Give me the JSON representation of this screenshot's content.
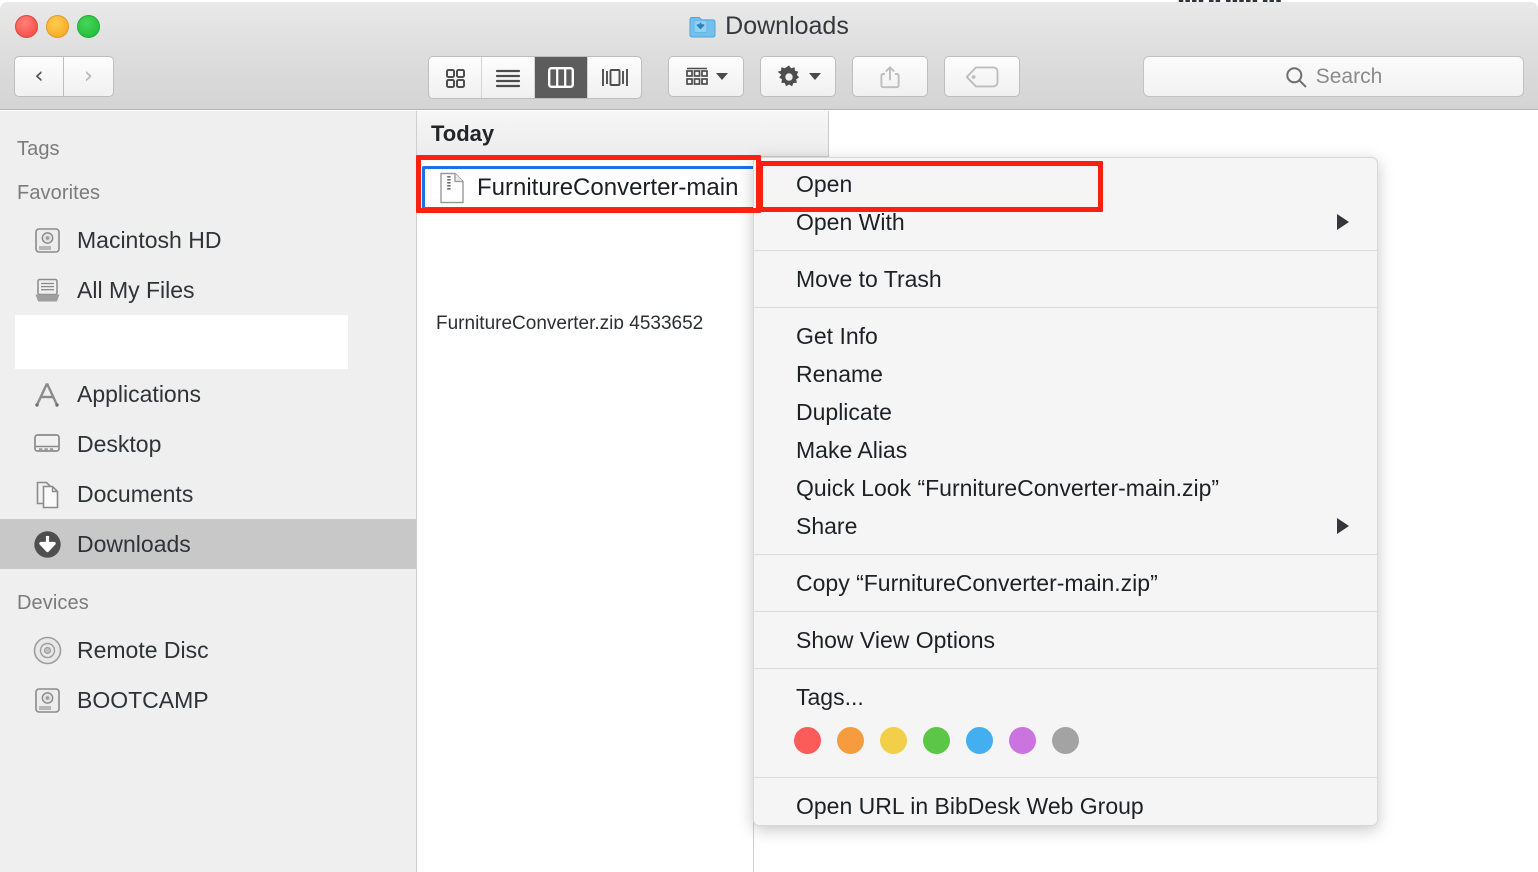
{
  "background": {
    "strip_text": "▮▮▮▮ ▮▮ ▮▮▮▮▮ ▮▮▮"
  },
  "window": {
    "title": "Downloads",
    "title_icon": "downloads-folder-icon",
    "traffic_lights": [
      {
        "name": "close-button",
        "color": "#f65650"
      },
      {
        "name": "minimize-button",
        "color": "#f7b02b"
      },
      {
        "name": "zoom-button",
        "color": "#26c23c"
      }
    ]
  },
  "toolbar": {
    "back_label": "‹",
    "forward_label": "›",
    "view_modes": [
      {
        "name": "icon-view",
        "icon": "grid-icon",
        "active": false
      },
      {
        "name": "list-view",
        "icon": "list-icon",
        "active": false
      },
      {
        "name": "column-view",
        "icon": "columns-icon",
        "active": true
      },
      {
        "name": "coverflow-view",
        "icon": "coverflow-icon",
        "active": false
      }
    ],
    "arrange_label": "arrange-icon",
    "action_label": "gear-icon",
    "share_label": "share-icon",
    "tags_label": "tag-icon",
    "accent": "#5c5c5c"
  },
  "search": {
    "placeholder": "Search",
    "icon": "search-icon"
  },
  "sidebar": {
    "sections": [
      {
        "header": "Tags",
        "items": []
      },
      {
        "header": "Favorites",
        "items": [
          {
            "label": "Macintosh HD",
            "icon": "hard-drive-icon",
            "selected": false
          },
          {
            "label": "All My Files",
            "icon": "all-my-files-icon",
            "selected": false
          },
          {
            "label": "",
            "icon": "blank-placeholder",
            "selected": false,
            "blank": true
          },
          {
            "label": "Applications",
            "icon": "applications-icon",
            "selected": false
          },
          {
            "label": "Desktop",
            "icon": "desktop-icon",
            "selected": false
          },
          {
            "label": "Documents",
            "icon": "documents-icon",
            "selected": false
          },
          {
            "label": "Downloads",
            "icon": "downloads-icon",
            "selected": true
          }
        ]
      },
      {
        "header": "Devices",
        "items": [
          {
            "label": "Remote Disc",
            "icon": "optical-disc-icon",
            "selected": false
          },
          {
            "label": "BOOTCAMP",
            "icon": "hard-drive-icon",
            "selected": false
          }
        ]
      }
    ]
  },
  "file_list": {
    "group_header": "Today",
    "rows": [
      {
        "name": "FurnitureConverter-main",
        "icon": "zip-file-icon",
        "selected": true
      },
      {
        "name": "FurnitureConverter.zip  4533652",
        "icon": "zip-file-icon",
        "selected": false
      }
    ]
  },
  "context_menu": {
    "items": [
      {
        "label": "Open",
        "submenu": false,
        "highlighted": true
      },
      {
        "label": "Open With",
        "submenu": true
      },
      {
        "separator": true
      },
      {
        "label": "Move to Trash",
        "submenu": false
      },
      {
        "separator": true
      },
      {
        "label": "Get Info",
        "submenu": false
      },
      {
        "label": "Rename",
        "submenu": false
      },
      {
        "label": "Duplicate",
        "submenu": false
      },
      {
        "label": "Make Alias",
        "submenu": false
      },
      {
        "label": "Quick Look “FurnitureConverter-main.zip”",
        "submenu": false
      },
      {
        "label": "Share",
        "submenu": true
      },
      {
        "separator": true
      },
      {
        "label": "Copy “FurnitureConverter-main.zip”",
        "submenu": false
      },
      {
        "separator": true
      },
      {
        "label": "Show View Options",
        "submenu": false
      },
      {
        "separator": true
      },
      {
        "label": "Tags...",
        "submenu": false
      },
      {
        "tags": true
      },
      {
        "separator": true
      },
      {
        "label": "Open URL in BibDesk Web Group",
        "submenu": false
      }
    ],
    "tag_colors": [
      "#fc5c59",
      "#f79c3e",
      "#f2cf49",
      "#5cc648",
      "#44aff0",
      "#cb74e0",
      "#a3a3a3"
    ]
  },
  "annotations": {
    "file_highlight_color": "#fb2012",
    "open_highlight_color": "#fb2012"
  }
}
